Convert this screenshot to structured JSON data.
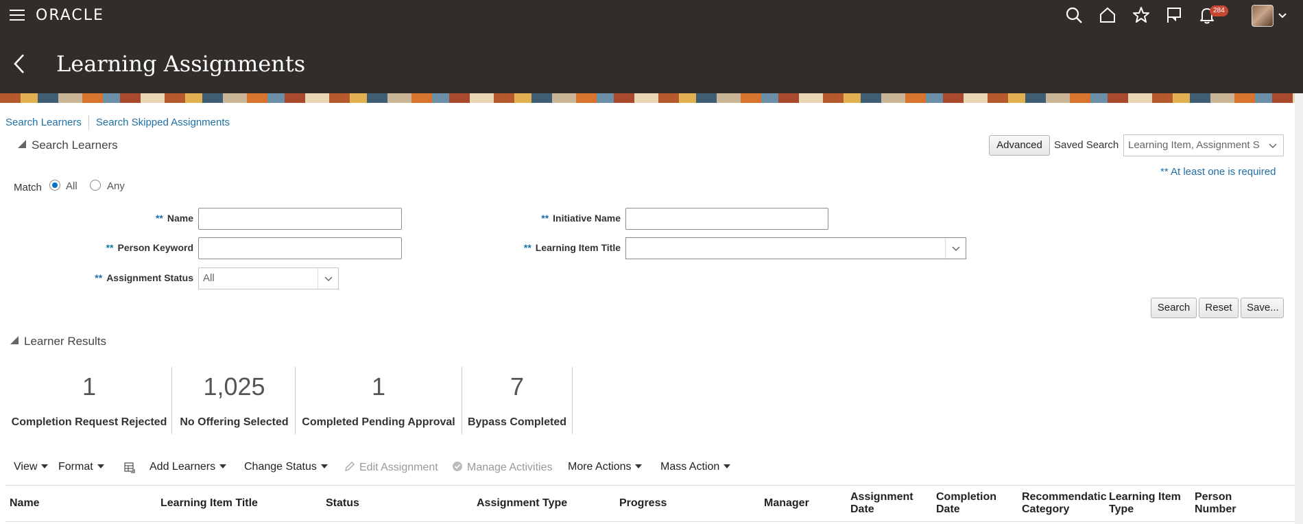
{
  "header": {
    "logo": "ORACLE",
    "notification_count": "284"
  },
  "page": {
    "title": "Learning Assignments"
  },
  "links": {
    "search_learners": "Search Learners",
    "search_skipped": "Search Skipped Assignments"
  },
  "search": {
    "section_title": "Search Learners",
    "advanced_label": "Advanced",
    "saved_search_label": "Saved Search",
    "saved_search_value": "Learning Item, Assignment S",
    "required_note": "** At least one is required",
    "match_label": "Match",
    "match_all": "All",
    "match_any": "Any",
    "match_selected": "All",
    "required_mark": "**",
    "fields": {
      "name": "Name",
      "initiative_name": "Initiative Name",
      "person_keyword": "Person Keyword",
      "learning_item_title": "Learning Item Title",
      "assignment_status": "Assignment Status",
      "assignment_status_value": "All"
    },
    "buttons": {
      "search": "Search",
      "reset": "Reset",
      "save": "Save..."
    }
  },
  "results": {
    "section_title": "Learner Results",
    "metrics": [
      {
        "value": "1",
        "label": "Completion Request Rejected"
      },
      {
        "value": "1,025",
        "label": "No Offering Selected"
      },
      {
        "value": "1",
        "label": "Completed Pending Approval"
      },
      {
        "value": "7",
        "label": "Bypass Completed"
      }
    ],
    "toolbar": {
      "view": "View",
      "format": "Format",
      "add_learners": "Add Learners",
      "change_status": "Change Status",
      "edit_assignment": "Edit Assignment",
      "manage_activities": "Manage Activities",
      "more_actions": "More Actions",
      "mass_action": "Mass Action"
    },
    "columns": [
      {
        "l1": "Name",
        "l2": ""
      },
      {
        "l1": "Learning Item Title",
        "l2": ""
      },
      {
        "l1": "Status",
        "l2": ""
      },
      {
        "l1": "Assignment Type",
        "l2": ""
      },
      {
        "l1": "Progress",
        "l2": ""
      },
      {
        "l1": "Manager",
        "l2": ""
      },
      {
        "l1": "Assignment",
        "l2": "Date"
      },
      {
        "l1": "Completion",
        "l2": "Date"
      },
      {
        "l1": "Recommendatic",
        "l2": "Category"
      },
      {
        "l1": "Learning Item",
        "l2": "Type"
      },
      {
        "l1": "Person",
        "l2": "Number"
      }
    ]
  }
}
